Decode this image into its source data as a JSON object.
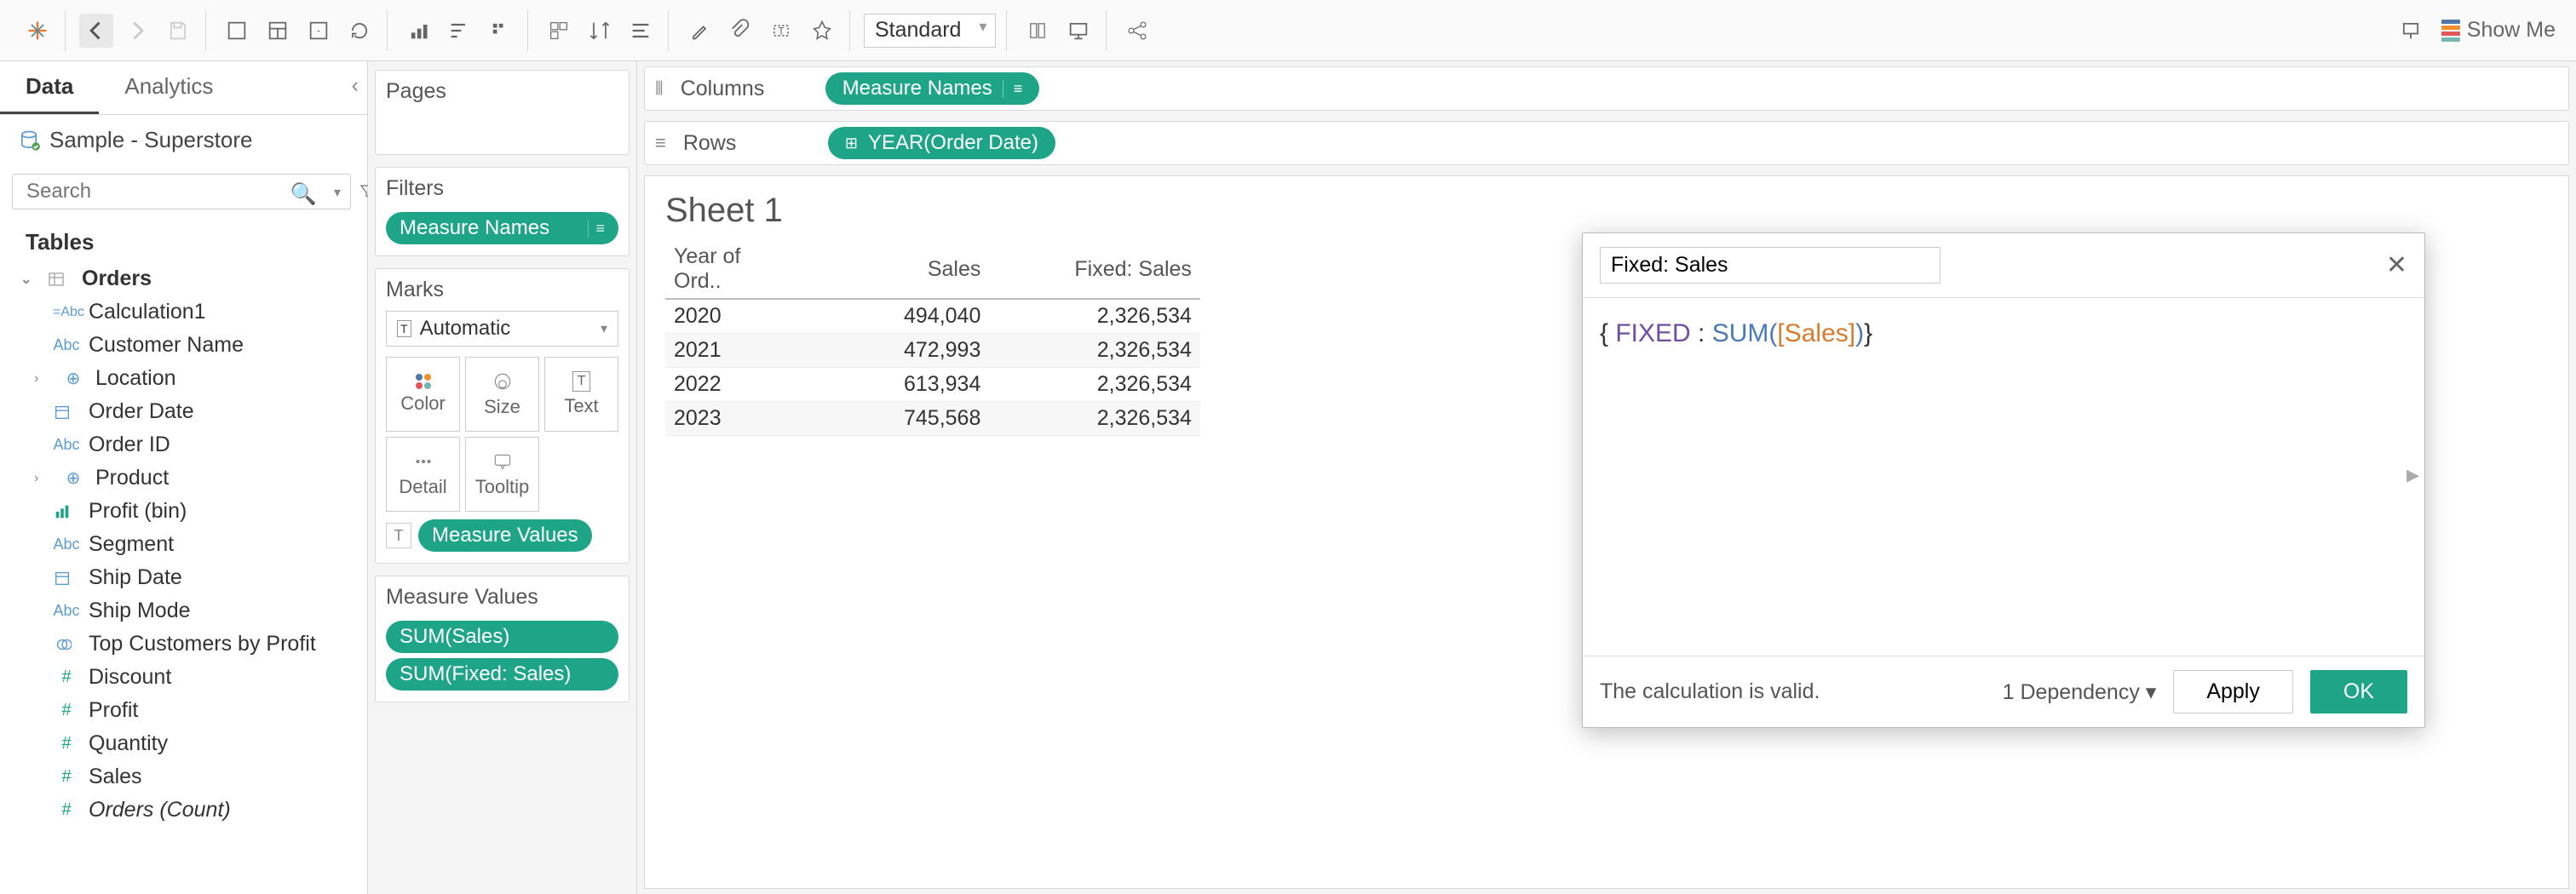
{
  "toolbar": {
    "fit_mode": "Standard",
    "showme": "Show Me"
  },
  "sidebar": {
    "tabs": {
      "data": "Data",
      "analytics": "Analytics"
    },
    "datasource": "Sample - Superstore",
    "search_placeholder": "Search",
    "section_tables": "Tables",
    "tree": {
      "orders": "Orders",
      "calc1": "Calculation1",
      "customer_name": "Customer Name",
      "location": "Location",
      "order_date": "Order Date",
      "order_id": "Order ID",
      "product": "Product",
      "profit_bin": "Profit (bin)",
      "segment": "Segment",
      "ship_date": "Ship Date",
      "ship_mode": "Ship Mode",
      "top_customers": "Top Customers by Profit",
      "discount": "Discount",
      "profit": "Profit",
      "quantity": "Quantity",
      "sales": "Sales",
      "orders_count": "Orders (Count)"
    }
  },
  "shelves": {
    "pages": "Pages",
    "filters": "Filters",
    "filter_pill": "Measure Names",
    "marks": "Marks",
    "marks_mode": "Automatic",
    "marks_buttons": {
      "color": "Color",
      "size": "Size",
      "text": "Text",
      "detail": "Detail",
      "tooltip": "Tooltip"
    },
    "marks_pill": "Measure Values",
    "measure_values": "Measure Values",
    "mv_pills": [
      "SUM(Sales)",
      "SUM(Fixed: Sales)"
    ]
  },
  "rowcol": {
    "columns_label": "Columns",
    "columns_pill": "Measure Names",
    "rows_label": "Rows",
    "rows_pill": "YEAR(Order Date)"
  },
  "sheet": {
    "title": "Sheet 1",
    "headers": [
      "Year of Ord..",
      "Sales",
      "Fixed: Sales"
    ],
    "rows": [
      {
        "year": "2020",
        "sales": "494,040",
        "fixed": "2,326,534"
      },
      {
        "year": "2021",
        "sales": "472,993",
        "fixed": "2,326,534"
      },
      {
        "year": "2022",
        "sales": "613,934",
        "fixed": "2,326,534"
      },
      {
        "year": "2023",
        "sales": "745,568",
        "fixed": "2,326,534"
      }
    ]
  },
  "calc": {
    "name": "Fixed: Sales",
    "formula_tokens": [
      "{ ",
      "FIXED",
      " : ",
      "SUM",
      "(",
      "[Sales]",
      ")",
      "}"
    ],
    "valid_msg": "The calculation is valid.",
    "dependency": "1 Dependency ▾",
    "apply": "Apply",
    "ok": "OK"
  }
}
